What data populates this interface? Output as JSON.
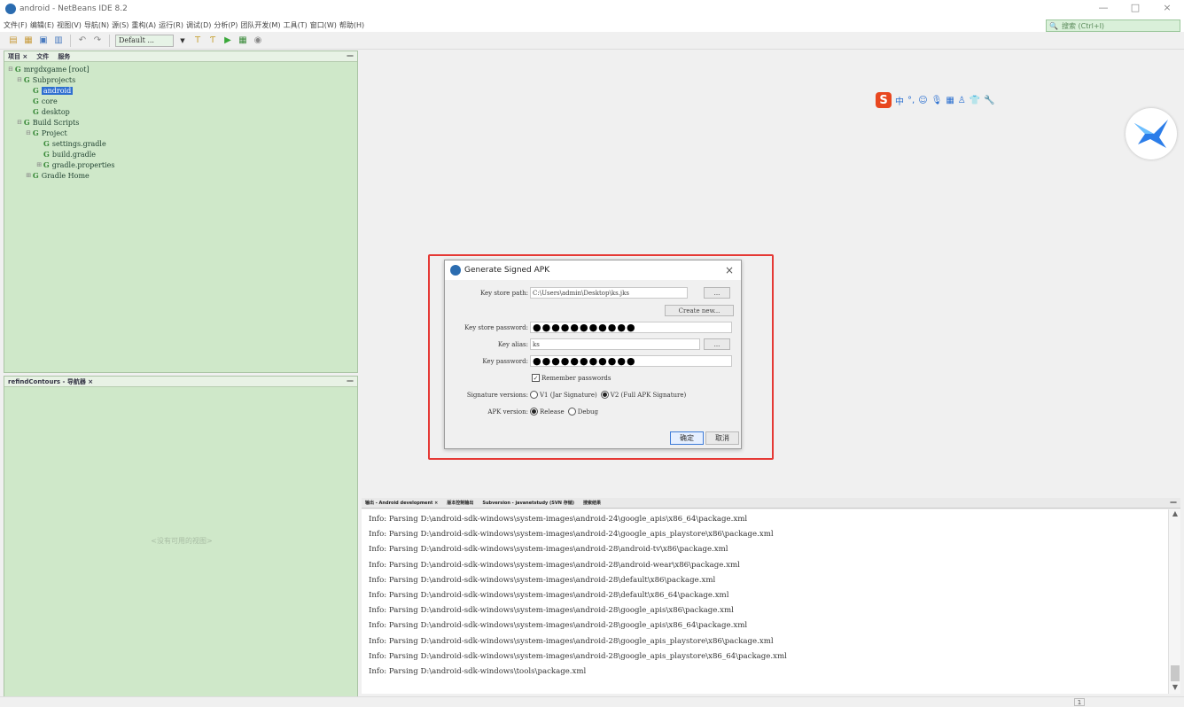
{
  "window": {
    "title": "android - NetBeans IDE 8.2",
    "minimize": "—",
    "maximize": "□",
    "close": "×"
  },
  "menu": [
    "文件(F)",
    "编辑(E)",
    "视图(V)",
    "导航(N)",
    "源(S)",
    "重构(A)",
    "运行(R)",
    "调试(D)",
    "分析(P)",
    "团队开发(M)",
    "工具(T)",
    "窗口(W)",
    "帮助(H)"
  ],
  "search": {
    "placeholder": "搜索 (Ctrl+I)"
  },
  "toolbar": {
    "config": "Default ..."
  },
  "projects_panel": {
    "tabs": [
      "项目 ×",
      "文件",
      "服务"
    ],
    "minimize": "—",
    "tree": [
      {
        "label": "mrgdxgame [root]",
        "level": 0,
        "icon": "G"
      },
      {
        "label": "Subprojects",
        "level": 1,
        "icon": "G"
      },
      {
        "label": "android",
        "level": 2,
        "icon": "G",
        "selected": true
      },
      {
        "label": "core",
        "level": 2,
        "icon": "G"
      },
      {
        "label": "desktop",
        "level": 2,
        "icon": "G"
      },
      {
        "label": "Build Scripts",
        "level": 1,
        "icon": "G"
      },
      {
        "label": "Project",
        "level": 2,
        "icon": "G"
      },
      {
        "label": "settings.gradle",
        "level": 3,
        "icon": "G"
      },
      {
        "label": "build.gradle",
        "level": 3,
        "icon": "G"
      },
      {
        "label": "gradle.properties",
        "level": 3,
        "icon": "G"
      },
      {
        "label": "Gradle Home",
        "level": 1,
        "icon": "G"
      }
    ]
  },
  "navigator_panel": {
    "tab": "refindContours - 导航器 ×",
    "minimize": "—",
    "empty_text": "<没有可用的视图>"
  },
  "dialog": {
    "title": "Generate Signed APK",
    "close": "×",
    "key_store_path_label": "Key store path:",
    "key_store_path_value": "C:\\Users\\admin\\Desktop\\ks.jks",
    "browse_label": "...",
    "create_new_label": "Create new...",
    "key_store_password_label": "Key store password:",
    "key_store_password_value": "●●●●●●●●●●●",
    "key_alias_label": "Key alias:",
    "key_alias_value": "ks",
    "key_password_label": "Key password:",
    "key_password_value": "●●●●●●●●●●●",
    "remember_label": "Remember passwords",
    "remember_checked": true,
    "signature_versions_label": "Signature versions:",
    "sig_v1_label": "V1 (Jar Signature)",
    "sig_v2_label": "V2 (Full APK Signature)",
    "apk_version_label": "APK version:",
    "release_label": "Release",
    "debug_label": "Debug",
    "ok_label": "确定",
    "cancel_label": "取消"
  },
  "output": {
    "tabs": [
      "输出 - Android development ×",
      "版本控制输出",
      "Subversion - javanetstudy (SVN 存储)",
      "搜索结果"
    ],
    "minimize": "—",
    "lines": [
      "Info: Parsing D:\\android-sdk-windows\\system-images\\android-24\\google_apis\\x86_64\\package.xml",
      "Info: Parsing D:\\android-sdk-windows\\system-images\\android-24\\google_apis_playstore\\x86\\package.xml",
      "Info: Parsing D:\\android-sdk-windows\\system-images\\android-28\\android-tv\\x86\\package.xml",
      "Info: Parsing D:\\android-sdk-windows\\system-images\\android-28\\android-wear\\x86\\package.xml",
      "Info: Parsing D:\\android-sdk-windows\\system-images\\android-28\\default\\x86\\package.xml",
      "Info: Parsing D:\\android-sdk-windows\\system-images\\android-28\\default\\x86_64\\package.xml",
      "Info: Parsing D:\\android-sdk-windows\\system-images\\android-28\\google_apis\\x86\\package.xml",
      "Info: Parsing D:\\android-sdk-windows\\system-images\\android-28\\google_apis\\x86_64\\package.xml",
      "Info: Parsing D:\\android-sdk-windows\\system-images\\android-28\\google_apis_playstore\\x86\\package.xml",
      "Info: Parsing D:\\android-sdk-windows\\system-images\\android-28\\google_apis_playstore\\x86_64\\package.xml",
      "Info: Parsing D:\\android-sdk-windows\\tools\\package.xml"
    ]
  },
  "ime": {
    "logo": "S",
    "mode": "中"
  },
  "status": {
    "indicator": "1"
  },
  "colors": {
    "panel_green": "#cfe8c9",
    "highlight_red": "#e53935",
    "selection_blue": "#2f6fd0"
  }
}
